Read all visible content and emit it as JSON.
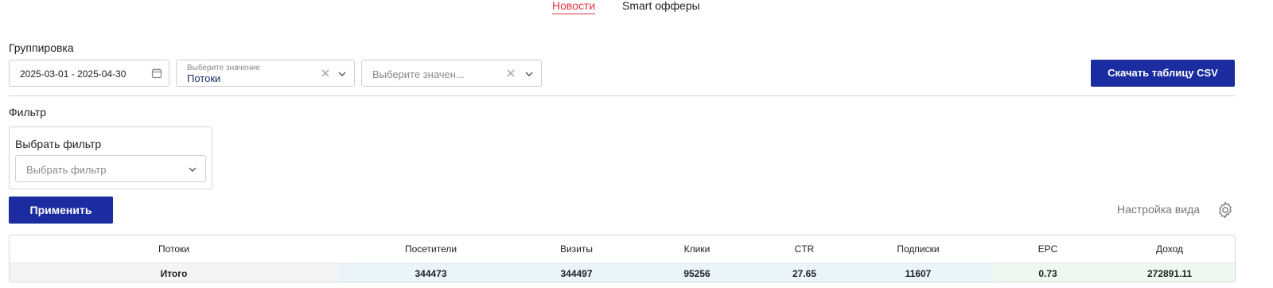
{
  "tabs": [
    {
      "label": "Новости",
      "active": true
    },
    {
      "label": "Smart офферы",
      "active": false
    }
  ],
  "grouping": {
    "label": "Группировка",
    "date_range": "2025-03-01 - 2025-04-30",
    "select1": {
      "hint": "Выберите значение",
      "value": "Потоки"
    },
    "select2": {
      "placeholder": "Выберите значен..."
    }
  },
  "download_csv_label": "Скачать таблицу CSV",
  "filter": {
    "label": "Фильтр",
    "box_title": "Выбрать фильтр",
    "select_placeholder": "Выбрать фильтр"
  },
  "apply_label": "Применить",
  "view_settings_label": "Настройка вида",
  "table": {
    "headers": [
      "Потоки",
      "Посетители",
      "Визиты",
      "Клики",
      "CTR",
      "Подписки",
      "EPC",
      "Доход"
    ],
    "total_row": [
      "Итого",
      "344473",
      "344497",
      "95256",
      "27.65",
      "11607",
      "0.73",
      "272891.11"
    ]
  },
  "colors": {
    "accent_red": "#e4343e",
    "primary_button": "#1a2ca0",
    "total_blue_bg": "#e9f4fb",
    "total_green_bg": "#edf8ef"
  }
}
